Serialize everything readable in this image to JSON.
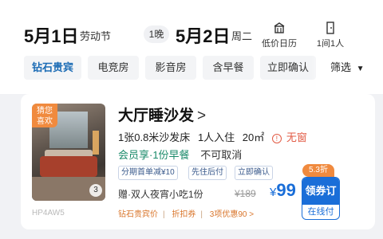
{
  "header": {
    "checkin": {
      "date": "5月1日",
      "note": "劳动节"
    },
    "nights": "1晚",
    "checkout": {
      "date": "5月2日",
      "weekday": "周二"
    },
    "tools": [
      {
        "icon": "calendar-building-icon",
        "label": "低价日历"
      },
      {
        "icon": "room-door-icon",
        "label": "1间1人"
      }
    ]
  },
  "filters": {
    "chips": [
      "钻石贵宾",
      "电竞房",
      "影音房",
      "含早餐",
      "立即确认"
    ],
    "sort_label": "筛选",
    "sort_icon": "caret-down-icon"
  },
  "room": {
    "photo_badge": "猜您喜欢",
    "photo_count": "3",
    "photo_code": "HP4AW5",
    "title": "大厅睡沙发",
    "title_arrow": ">",
    "bed": "1张0.8米沙发床",
    "occupancy": "1人入住",
    "area": "20㎡",
    "window_icon": "!",
    "window": "无窗",
    "member": "会员享·1份早餐",
    "cancel": "不可取消",
    "tags": [
      "分期首单减¥10",
      "先住后付",
      "立即确认"
    ],
    "gift": "赠·双人夜宵小吃1份",
    "original_price": "¥189",
    "price_symbol": "¥",
    "price": "99",
    "discount_badge": "5.3折",
    "book_label": "领券订",
    "book_sub": "在线付",
    "promos": [
      "钻石贵宾价",
      "折扣券",
      "3项优惠90 >"
    ]
  },
  "colors": {
    "accent": "#1a6ed8",
    "orange": "#f08a3e",
    "green": "#1a8a6a",
    "warning": "#e25b45"
  }
}
